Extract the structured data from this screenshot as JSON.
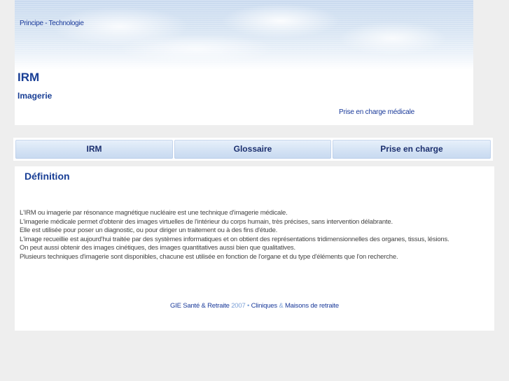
{
  "header": {
    "top_link": "Principe - Technologie",
    "title": "IRM",
    "subtitle": "Imagerie",
    "right_link": "Prise en charge médicale"
  },
  "nav": {
    "tabs": [
      {
        "label": "IRM"
      },
      {
        "label": "Glossaire"
      },
      {
        "label": "Prise en charge"
      }
    ]
  },
  "content": {
    "section_title": "Définition",
    "paragraphs": [
      "L'IRM ou imagerie par résonance magnétique nucléaire est une technique d'imagerie médicale.",
      "L'imagerie médicale permet d'obtenir des images virtuelles de l'intérieur du corps humain, très précises, sans intervention délabrante.",
      "Elle est utilisée pour poser un diagnostic, ou pour diriger un traitement ou à des fins d'étude.",
      "L'image recueillie est aujourd'hui traitée par des systèmes informatiques et on obtient des représentations tridimensionnelles des organes, tissus, lésions.",
      "On peut aussi obtenir des images cinétiques, des images quantitatives aussi bien que qualitatives.",
      "Plusieurs techniques d'imagerie sont disponibles, chacune est utilisée en fonction de l'organe et du type d'éléments que l'on recherche."
    ]
  },
  "footer": {
    "org_link": "GIE Santé & Retraite",
    "year": "2007",
    "separator": "•",
    "clinics_link": "Cliniques",
    "ampersand": "&",
    "homes_link": "Maisons de retraite"
  },
  "colors": {
    "title_blue": "#183e95",
    "link_blue": "#1a3a9a",
    "nav_text": "#1b2f6e",
    "body_text": "#444444",
    "page_bg": "#eeeeee"
  }
}
